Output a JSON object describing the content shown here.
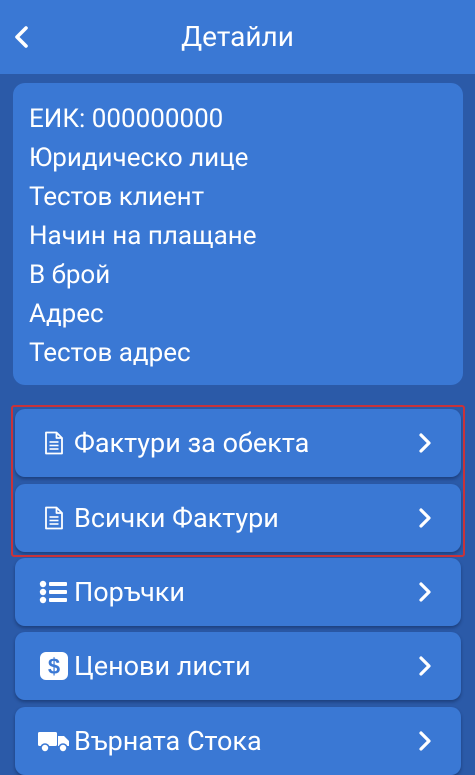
{
  "header": {
    "title": "Детайли",
    "back_icon": "chevron-left-icon"
  },
  "details": {
    "lines": [
      "ЕИК: 000000000",
      "Юридическо лице",
      "Тестов клиент",
      "Начин на плащане",
      "В брой",
      "Адрес",
      "Тестов адрес"
    ]
  },
  "menu": {
    "items": [
      {
        "label": "Фактури за обекта",
        "icon": "document-icon"
      },
      {
        "label": "Всички Фактури",
        "icon": "document-icon"
      },
      {
        "label": "Поръчки",
        "icon": "list-icon"
      },
      {
        "label": "Ценови листи",
        "icon": "dollar-icon"
      },
      {
        "label": "Върната Стока",
        "icon": "truck-icon"
      }
    ]
  },
  "colors": {
    "background": "#2b5aa8",
    "header": "#3a78d4",
    "card": "#3a78d4",
    "selection_outline": "#c8333a",
    "text": "#ffffff"
  }
}
